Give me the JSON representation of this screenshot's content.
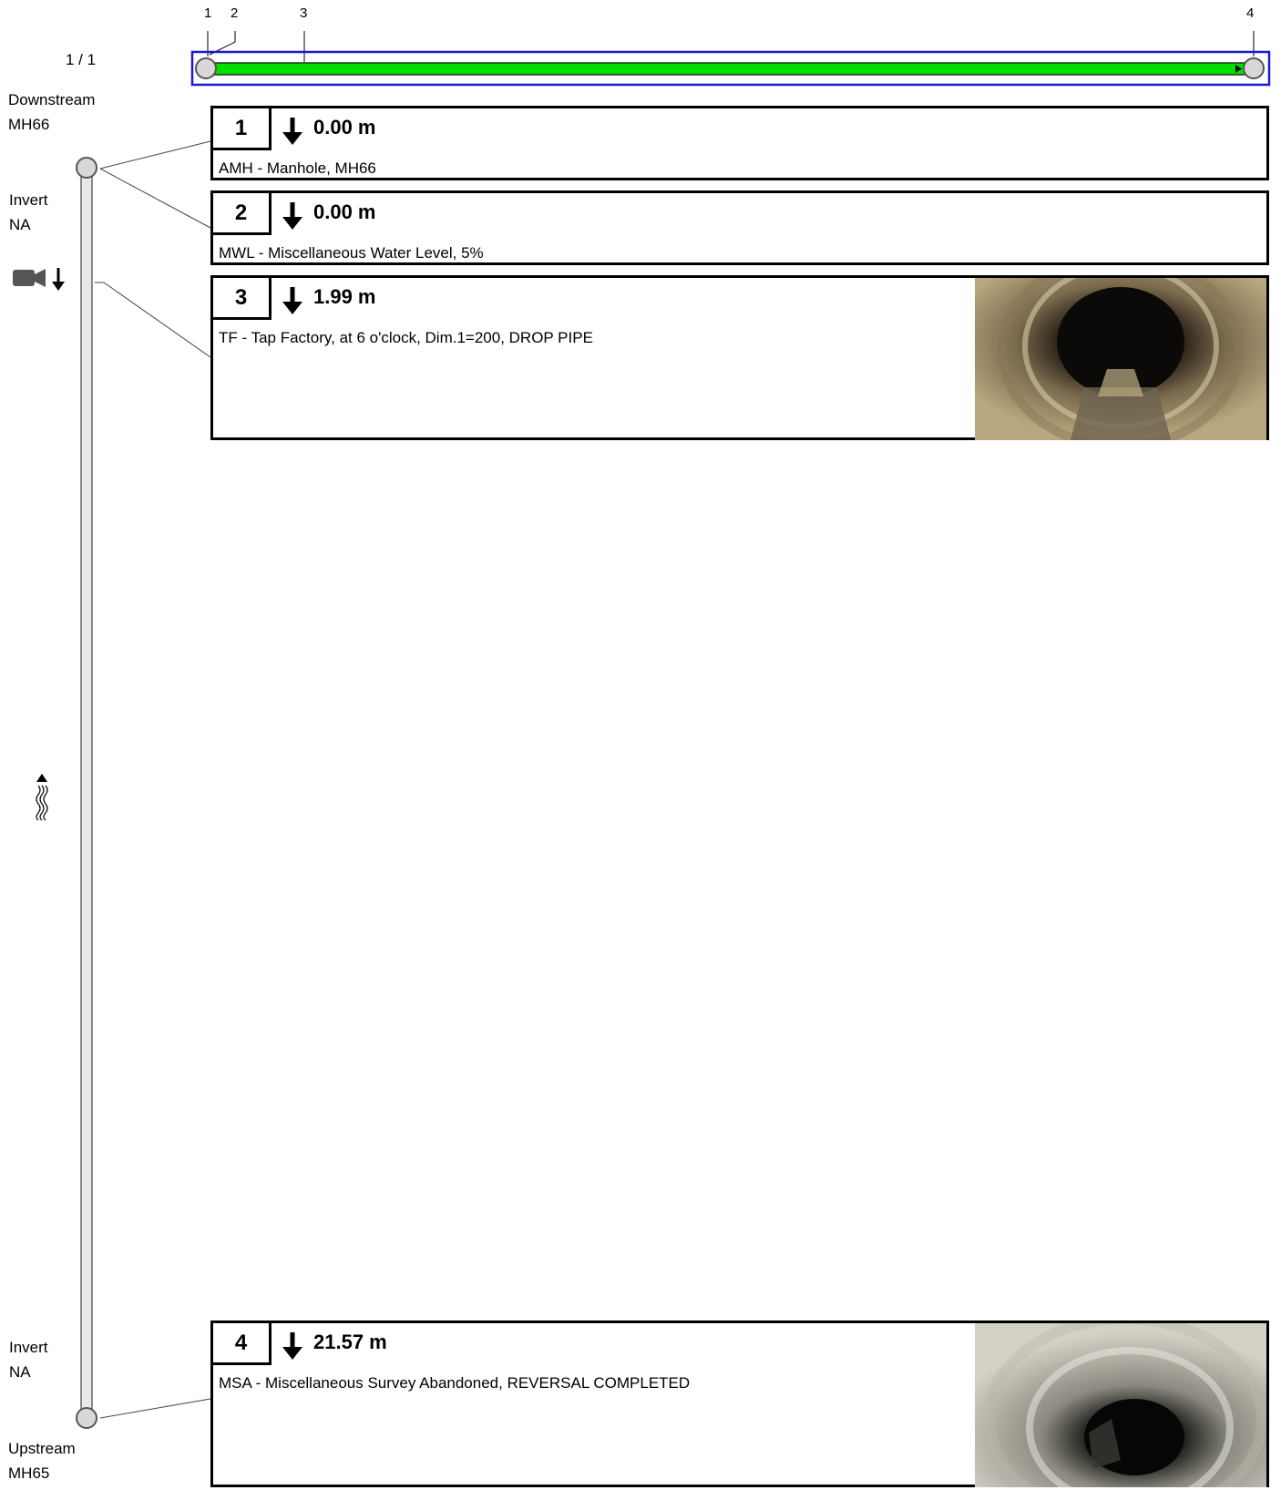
{
  "page_indicator": "1 / 1",
  "overview": {
    "tick_labels": [
      "1",
      "2",
      "3",
      "4"
    ]
  },
  "left_panel": {
    "downstream_label": "Downstream",
    "downstream_node": "MH66",
    "invert_top_label": "Invert",
    "invert_top_value": "NA",
    "invert_bottom_label": "Invert",
    "invert_bottom_value": "NA",
    "upstream_label": "Upstream",
    "upstream_node": "MH65"
  },
  "observations": [
    {
      "num": "1",
      "distance": "0.00 m",
      "description": "AMH - Manhole, MH66"
    },
    {
      "num": "2",
      "distance": "0.00 m",
      "description": "MWL - Miscellaneous Water Level, 5%"
    },
    {
      "num": "3",
      "distance": "1.99 m",
      "description": "TF - Tap Factory, at 6 o'clock, Dim.1=200, DROP PIPE"
    },
    {
      "num": "4",
      "distance": "21.57 m",
      "description": "MSA - Miscellaneous Survey Abandoned, REVERSAL COMPLETED"
    }
  ],
  "colors": {
    "pipe_fill": "#00e000",
    "overview_border": "#1a1ad0"
  },
  "icons": {
    "camera": "camera-direction-icon",
    "flow": "flow-direction-icon",
    "arrow": "down-arrow-icon"
  }
}
